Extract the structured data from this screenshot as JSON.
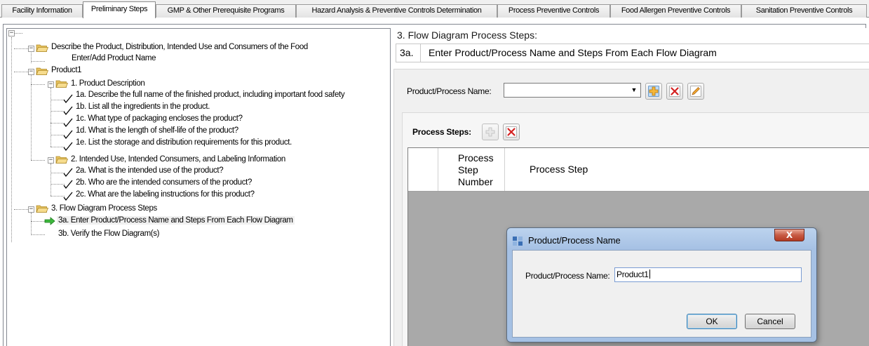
{
  "tabs": [
    {
      "label": "Facility Information",
      "active": false
    },
    {
      "label": "Preliminary Steps",
      "active": true
    },
    {
      "label": "GMP & Other Prerequisite Programs",
      "active": false
    },
    {
      "label": "Hazard Analysis & Preventive Controls Determination",
      "active": false
    },
    {
      "label": "Process Preventive Controls",
      "active": false
    },
    {
      "label": "Food Allergen Preventive Controls",
      "active": false
    },
    {
      "label": "Sanitation Preventive Controls",
      "active": false
    }
  ],
  "tree": {
    "items": [
      {
        "label": "Describe the Product, Distribution, Intended Use and Consumers of the Food"
      },
      {
        "label": "Enter/Add Product Name"
      },
      {
        "label": "Product1"
      },
      {
        "label": "1. Product Description"
      },
      {
        "label": "1a. Describe the full name of the finished product, including important food safety"
      },
      {
        "label": "1b. List all the ingredients in the product."
      },
      {
        "label": "1c. What type of packaging encloses the product?"
      },
      {
        "label": "1d. What is the length of shelf-life of the product?"
      },
      {
        "label": "1e. List the storage and distribution requirements for this product."
      },
      {
        "label": "2. Intended Use, Intended Consumers, and Labeling Information"
      },
      {
        "label": "2a. What is the intended use of the product?"
      },
      {
        "label": "2b. Who are the intended consumers of the product?"
      },
      {
        "label": "2c. What are the labeling instructions for this product?"
      },
      {
        "label": "3. Flow Diagram Process Steps"
      },
      {
        "label": "3a. Enter Product/Process Name and Steps From Each Flow Diagram"
      },
      {
        "label": "3b. Verify the Flow Diagram(s)"
      }
    ]
  },
  "main": {
    "section_title": "3. Flow Diagram Process Steps:",
    "step_number": "3a.",
    "step_text": "Enter Product/Process Name and Steps From Each Flow Diagram",
    "product_label": "Product/Process Name:",
    "combo_value": "",
    "process_steps_label": "Process Steps:",
    "grid": {
      "col1": [
        "Process",
        "Step",
        "Number"
      ],
      "col2": "Process Step"
    }
  },
  "dialog": {
    "title": "Product/Process Name",
    "close_label": "X",
    "field_label": "Product/Process Name:",
    "field_value": "Product1",
    "ok_label": "OK",
    "cancel_label": "Cancel"
  },
  "colors": {
    "arrow": "#2fa82f",
    "folder": "#f2d27a",
    "add": "#f0a020",
    "delete": "#d42020",
    "edit": "#e8a030"
  }
}
